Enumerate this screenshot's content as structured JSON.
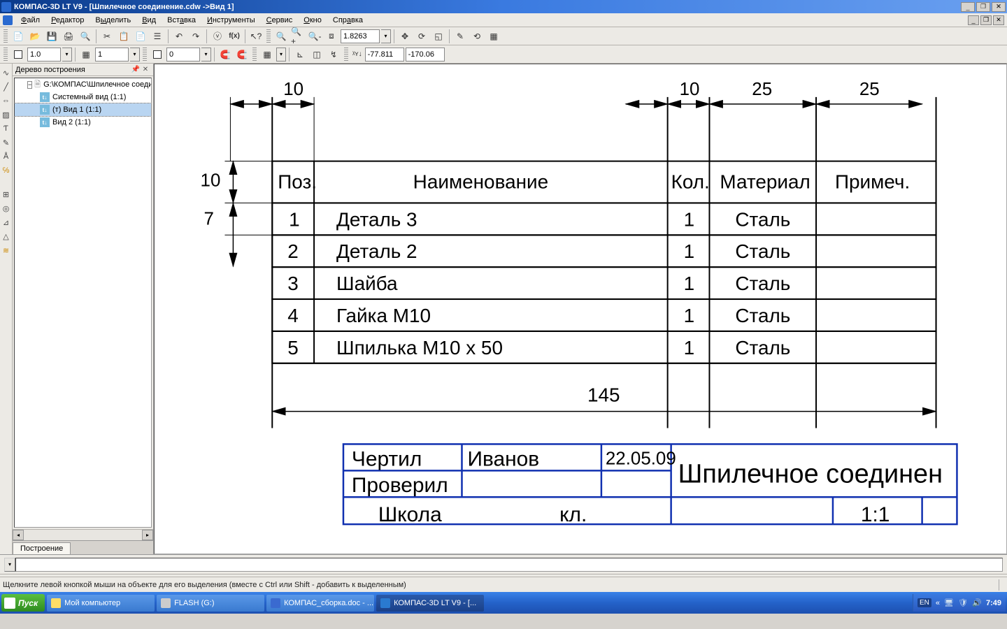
{
  "title_bar": {
    "title": "КОМПАС-3D LT V9 - [Шпилечное соединение.cdw ->Вид 1]"
  },
  "menu": {
    "file": "Файл",
    "edit": "Редактор",
    "select": "Выделить",
    "view": "Вид",
    "insert": "Вставка",
    "tools": "Инструменты",
    "service": "Сервис",
    "window": "Окно",
    "help": "Справка"
  },
  "toolbar1": {
    "zoom": "1.8263"
  },
  "toolbar2": {
    "style_left": "1.0",
    "layer": "1",
    "style_right": "0",
    "coord_x": "-77.811",
    "coord_y": "-170.06",
    "xy_label": "ᵡʏ↓"
  },
  "tree": {
    "title": "Дерево построения",
    "root": "G:\\КОМПАС\\Шпилечное соединен",
    "items": [
      "Системный вид (1:1)",
      "(т) Вид 1 (1:1)",
      "Вид 2 (1:1)"
    ],
    "tab": "Построение"
  },
  "drawing": {
    "dims": {
      "left_top": "10",
      "right_top1": "10",
      "right_top2": "25",
      "right_top3": "25",
      "left_side_a": "10",
      "left_side_b": "7",
      "bottom": "145"
    },
    "headers": {
      "pos": "Поз.",
      "name": "Наименование",
      "qty": "Кол.",
      "mat": "Материал",
      "note": "Примеч."
    },
    "rows": [
      {
        "pos": "1",
        "name": "Деталь 3",
        "qty": "1",
        "mat": "Сталь",
        "note": ""
      },
      {
        "pos": "2",
        "name": "Деталь 2",
        "qty": "1",
        "mat": "Сталь",
        "note": ""
      },
      {
        "pos": "3",
        "name": "Шайба",
        "qty": "1",
        "mat": "Сталь",
        "note": ""
      },
      {
        "pos": "4",
        "name": "Гайка М10",
        "qty": "1",
        "mat": "Сталь",
        "note": ""
      },
      {
        "pos": "5",
        "name": "Шпилька М10 х 50",
        "qty": "1",
        "mat": "Сталь",
        "note": ""
      }
    ],
    "stamp": {
      "drew_lbl": "Чертил",
      "drew_name": "Иванов",
      "drew_date": "22.05.09",
      "checked_lbl": "Проверил",
      "title": "Шпилечное соединен",
      "school": "Школа",
      "class": "кл.",
      "scale": "1:1"
    }
  },
  "status": {
    "text": "Щелкните левой кнопкой мыши на объекте для его выделения (вместе с Ctrl или Shift - добавить к выделенным)"
  },
  "taskbar": {
    "start": "Пуск",
    "items": [
      "Мой компьютер",
      "FLASH (G:)",
      "КОМПАС_сборка.doc - ...",
      "КОМПАС-3D LT V9 - [..."
    ],
    "lang": "EN",
    "clock": "7:49",
    "arrows": "«"
  }
}
